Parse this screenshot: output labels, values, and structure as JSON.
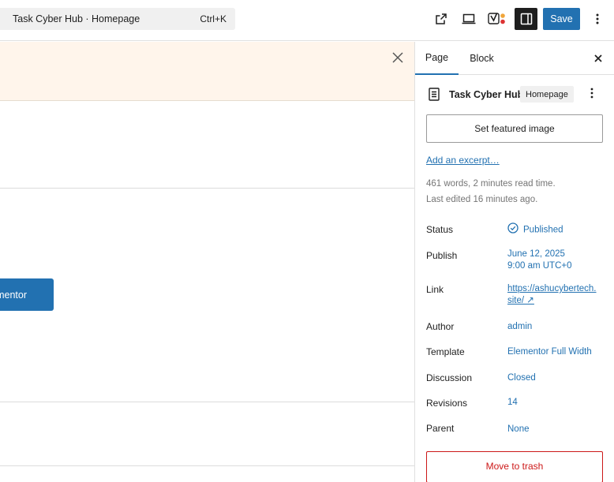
{
  "header": {
    "command_bar": {
      "title": "Task Cyber Hub · Homepage",
      "shortcut": "Ctrl+K"
    },
    "save_label": "Save",
    "icons": [
      "external-link-icon",
      "desktop-preview-icon",
      "yoast-icon",
      "sidebar-toggle-icon",
      "more-vertical-icon"
    ]
  },
  "canvas": {
    "button_label": "mentor"
  },
  "sidebar": {
    "tabs": [
      {
        "label": "Page",
        "active": true
      },
      {
        "label": "Block",
        "active": false
      }
    ],
    "document": {
      "title": "Task Cyber Hub",
      "badge": "Homepage"
    },
    "featured_image_label": "Set featured image",
    "excerpt_label": "Add an excerpt…",
    "stats": {
      "words": "461 words, 2 minutes read time.",
      "edited": "Last edited 16 minutes ago."
    },
    "rows": {
      "status": {
        "label": "Status",
        "value": "Published"
      },
      "publish": {
        "label": "Publish",
        "date": "June 12, 2025",
        "time": "9:00 am UTC+0"
      },
      "link": {
        "label": "Link",
        "line1": "https://ashucybertech.",
        "line2": "site/ ↗"
      },
      "author": {
        "label": "Author",
        "value": "admin"
      },
      "template": {
        "label": "Template",
        "value": "Elementor Full Width"
      },
      "discussion": {
        "label": "Discussion",
        "value": "Closed"
      },
      "revisions": {
        "label": "Revisions",
        "value": "14"
      },
      "parent": {
        "label": "Parent",
        "value": "None"
      }
    },
    "trash_label": "Move to trash"
  },
  "colors": {
    "accent": "#2271b1",
    "danger": "#cc1818",
    "notice_bg": "#fff5eb"
  }
}
